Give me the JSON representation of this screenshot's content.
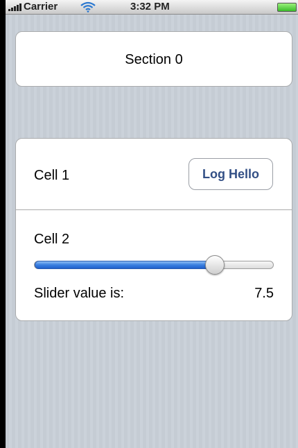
{
  "status_bar": {
    "carrier": "Carrier",
    "time": "3:32 PM"
  },
  "sections": {
    "section0_title": "Section 0",
    "cell1": {
      "label": "Cell 1",
      "button_label": "Log Hello"
    },
    "cell2": {
      "label": "Cell 2",
      "slider_caption": "Slider value is:",
      "slider_value_text": "7.5",
      "slider_fraction": 0.75
    }
  },
  "colors": {
    "accent": "#3a7fe0",
    "button_text": "#324f85",
    "background": "#c5ccd4"
  }
}
